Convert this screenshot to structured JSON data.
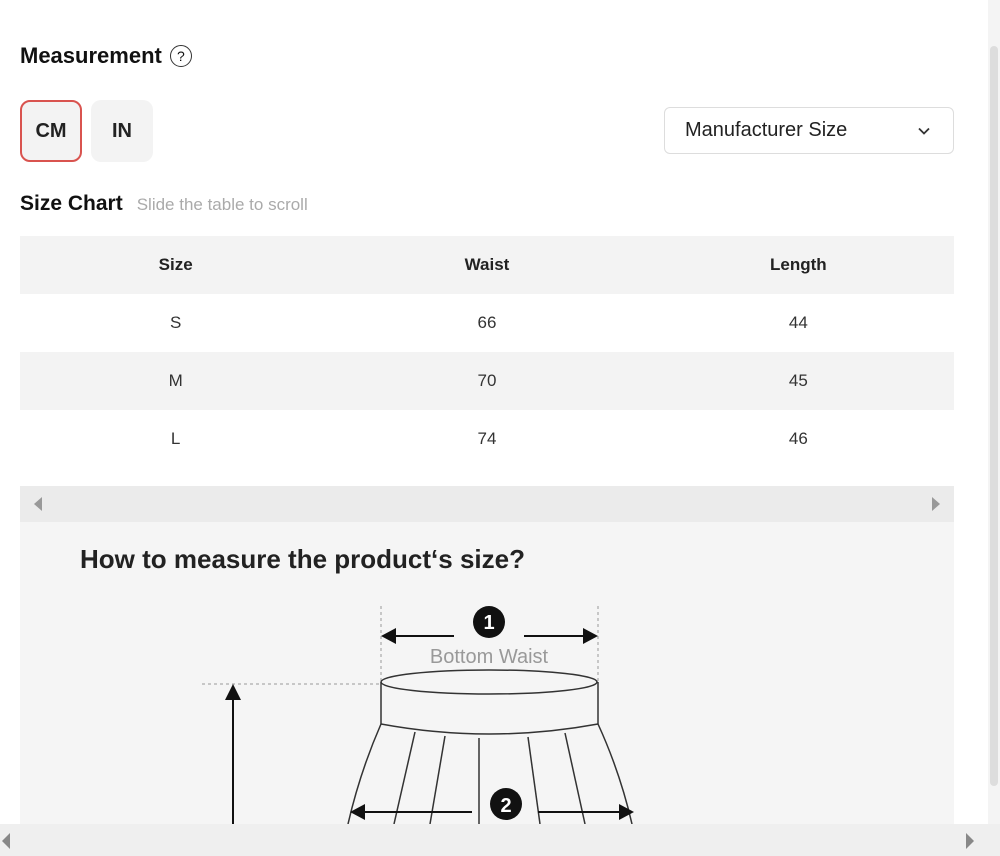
{
  "measurement": {
    "title": "Measurement",
    "help_glyph": "?"
  },
  "units": [
    {
      "label": "CM",
      "selected": true
    },
    {
      "label": "IN",
      "selected": false
    }
  ],
  "size_select": {
    "value": "Manufacturer Size"
  },
  "size_chart": {
    "title": "Size Chart",
    "hint": "Slide the table to scroll",
    "columns": [
      "Size",
      "Waist",
      "Length"
    ],
    "rows": [
      [
        "S",
        "66",
        "44"
      ],
      [
        "M",
        "70",
        "45"
      ],
      [
        "L",
        "74",
        "46"
      ]
    ]
  },
  "guide": {
    "title": "How to measure the product‘s size?",
    "marker1": "1",
    "marker1_label": "Bottom Waist",
    "marker2": "2"
  },
  "colors": {
    "active_border": "#d9534f",
    "table_stripe": "#f3f3f3"
  }
}
